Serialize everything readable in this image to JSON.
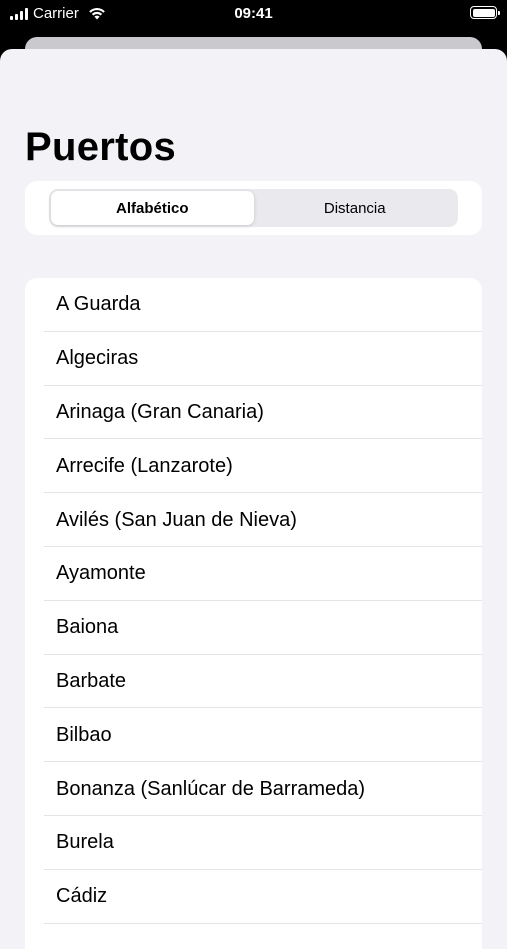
{
  "status_bar": {
    "carrier": "Carrier",
    "time": "09:41",
    "icons": [
      "signal-icon",
      "wifi-icon",
      "battery-icon"
    ]
  },
  "page": {
    "title": "Puertos"
  },
  "segmented_control": {
    "options": [
      "Alfabético",
      "Distancia"
    ],
    "selected": "Alfabético"
  },
  "ports": [
    "A Guarda",
    "Algeciras",
    "Arinaga (Gran Canaria)",
    "Arrecife (Lanzarote)",
    "Avilés (San Juan de Nieva)",
    "Ayamonte",
    "Baiona",
    "Barbate",
    "Bilbao",
    "Bonanza (Sanlúcar de Barrameda)",
    "Burela",
    "Cádiz"
  ],
  "colors": {
    "background": "#f2f2f7",
    "card": "#ffffff",
    "text": "#000000",
    "separator": "#e3e3e8"
  }
}
